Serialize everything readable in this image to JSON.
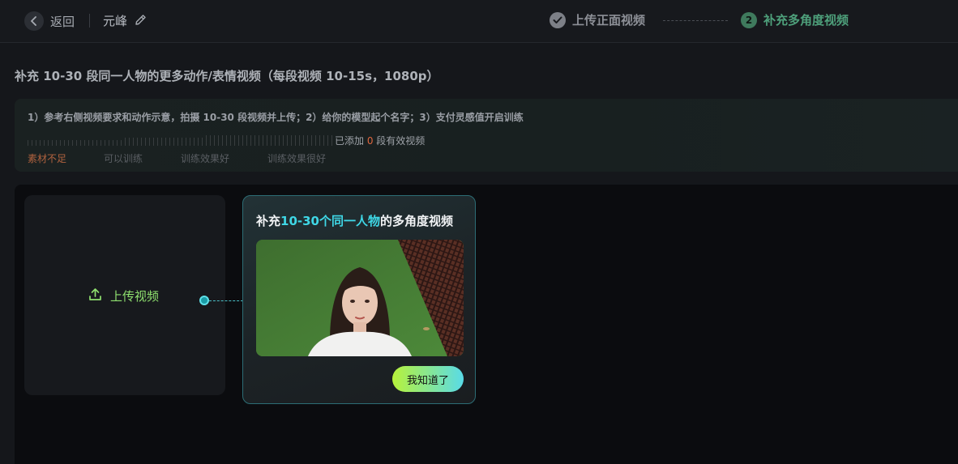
{
  "header": {
    "back_label": "返回",
    "project_name": "元峰",
    "steps": [
      {
        "label": "上传正面视频",
        "state": "done"
      },
      {
        "number": "2",
        "label": "补充多角度视频",
        "state": "active"
      }
    ]
  },
  "main": {
    "subtitle": "补充 10-30 段同一人物的更多动作/表情视频（每段视频 10-15s，1080p）",
    "instructions": "1）参考右侧视频要求和动作示意，拍摄 10-30 段视频并上传；2）给你的模型起个名字；3）支付灵感值开启训练",
    "progress": {
      "added_prefix": "已添加 ",
      "added_count": "0",
      "added_suffix": " 段有效视频",
      "fraction": 0,
      "levels": [
        "素材不足",
        "可以训练",
        "训练效果好",
        "训练效果很好"
      ]
    },
    "upload": {
      "label": "上传视频"
    }
  },
  "tooltip": {
    "title_prefix": "补充",
    "title_highlight": "10-30个同一人物",
    "title_suffix": "的多角度视频",
    "button_label": "我知道了"
  },
  "colors": {
    "accent_green": "#8fe06f",
    "accent_cyan": "#3fd7e6",
    "active_step": "#4ea07b",
    "warning_orange": "#e0673f"
  }
}
